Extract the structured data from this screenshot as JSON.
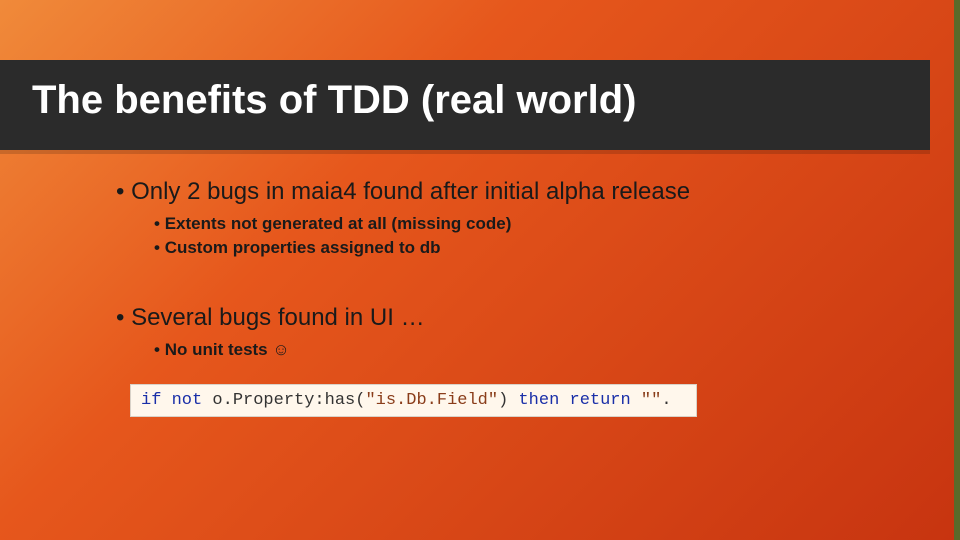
{
  "title": "The benefits of TDD (real world)",
  "bullets": {
    "b1": "Only 2 bugs in maia4 found after initial alpha release",
    "b1a": "Extents not generated at all (missing code)",
    "b1b": "Custom properties assigned to db",
    "b2": "Several bugs found in UI …",
    "b2a": "No unit tests ☺"
  },
  "code": {
    "kw_if": "if",
    "kw_not": "not",
    "prefix": " o.Property:",
    "method": "has",
    "open_paren": "(",
    "string": "\"is.Db.Field\"",
    "close_paren": ") ",
    "kw_then": "then",
    "kw_return": "return",
    "empty": "\"\"",
    "dot": "."
  }
}
